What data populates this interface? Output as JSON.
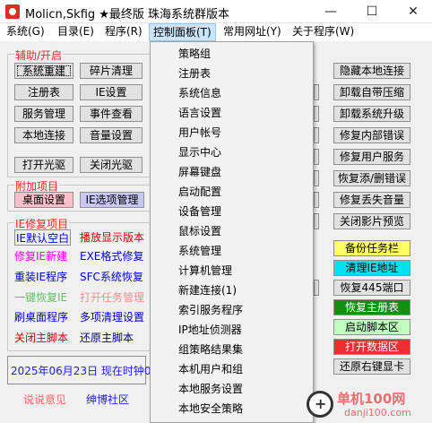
{
  "window": {
    "title": "Molicn,Skfig ★最终版 珠海系统群版本",
    "minimize_glyph": "—",
    "maximize_glyph": "☐",
    "close_glyph": "✕"
  },
  "menubar": [
    "系统(G)",
    "目录(E)",
    "程序(R)",
    "控制面板(T)",
    "常用网址(Y)",
    "关于程序(W)"
  ],
  "groups": {
    "assist_title": "辅助/开启",
    "addon_title": "附加项目",
    "ie_title": "IE修复项目"
  },
  "left_buttons": {
    "restart": "系统重建",
    "defrag": "碎片清理",
    "registry": "注册表",
    "ie_settings": "IE设置",
    "service_mgmt": "服务管理",
    "event_viewer": "事件查看",
    "local_conn": "本地连接",
    "volume": "音量设置",
    "open_cd": "打开光驱",
    "close_cd": "关闭光驱",
    "desktop_settings": "桌面设置",
    "ie_options": "IE选项管理"
  },
  "ie_links": {
    "ie_default_blank": "IE默认空白",
    "show_version": "播放显示版本",
    "fix_ie_new": "修复IE新建",
    "exe_format": "EXE格式修复",
    "reinstall_ie": "重装IE程序",
    "sfc_restore": "SFC系统恢复",
    "one_click_ie": "一键恢复IE",
    "open_task_mgr": "打开任务管理",
    "refresh_desktop": "刷桌面程序",
    "multi_clean": "多项清理设置",
    "close_main_script": "关闭主脚本",
    "restore_main_script": "还原主脚本"
  },
  "status": {
    "date_text": "2025年06月23日 现在时钟08",
    "feedback": "说说意见",
    "community": "绅博社区"
  },
  "right_buttons": {
    "hide_local_conn": "隐藏本地连接",
    "uninstall_zip": "卸载自带压缩",
    "uninstall_upgrade": "卸载系统升级",
    "fix_internal": "修复内部错误",
    "fix_user_service": "修复用户服务",
    "restore_delete_error": "恢复添/删错误",
    "fix_lost_volume": "修复丢失音量",
    "close_preview": "关闭影片预览",
    "backup_taskbar": "备份任务栏",
    "clean_ie_address": "清理IE地址",
    "restore_port_445": "恢复445端口",
    "restore_main_tab": "恢复主册表",
    "start_script_area": "启动脚本区",
    "open_data_area": "打开数据区",
    "restore_right_key": "还原右键显卡"
  },
  "control_panel_menu": [
    "策略组",
    "注册表",
    "系统信息",
    "语言设置",
    "用户帐号",
    "显示中心",
    "屏幕键盘",
    "启动配置",
    "设备管理",
    "鼠标设置",
    "系统管理",
    "计算机管理",
    "新建连接(1)",
    "索引服务程序",
    "IP地址侦测器",
    "组策略结果集",
    "本机用户和组",
    "本地服务设置",
    "本地安全策略"
  ],
  "watermark": {
    "brand": "单机100网",
    "domain": "danji100.com"
  }
}
